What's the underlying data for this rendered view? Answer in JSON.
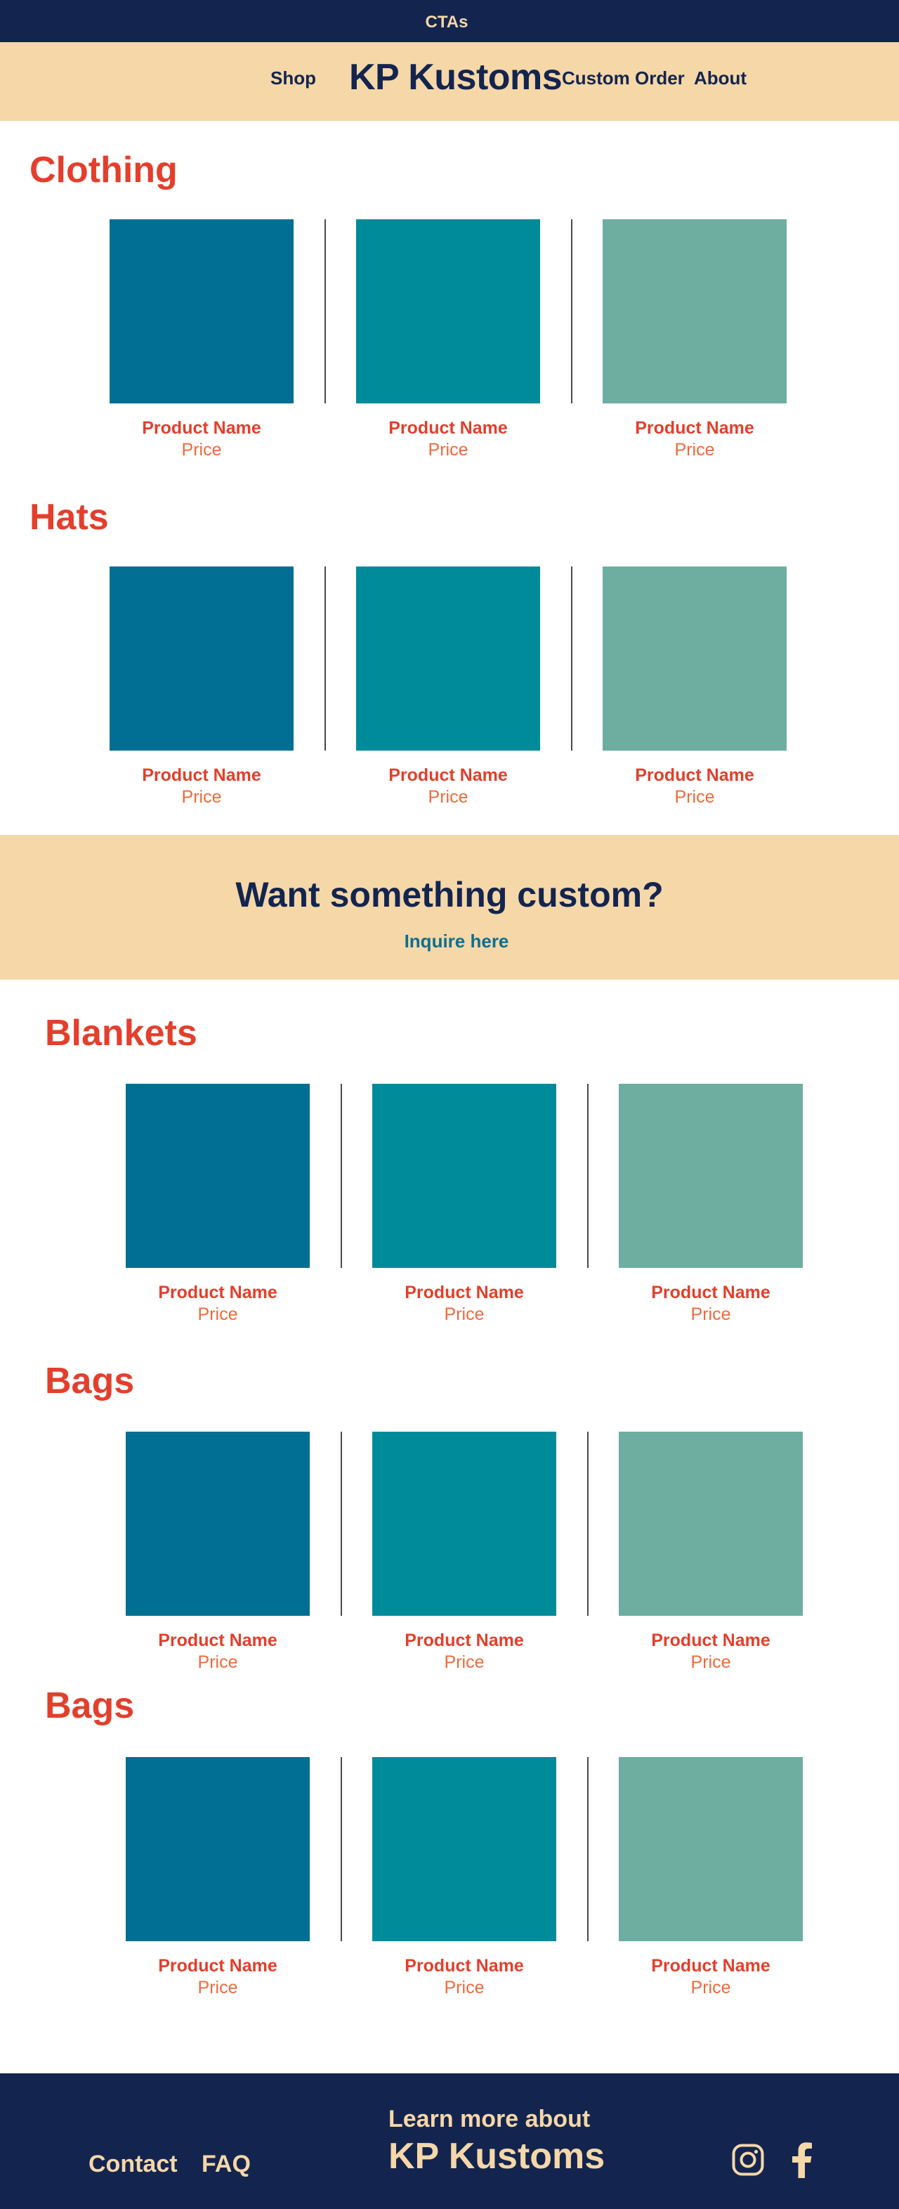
{
  "topbar": {
    "text": "CTAs"
  },
  "header": {
    "brand": "KP Kustoms",
    "nav": {
      "shop": "Shop",
      "custom_order": "Custom Order",
      "about": "About"
    }
  },
  "sections": [
    {
      "title": "Clothing",
      "products": [
        {
          "name": "Product Name",
          "price": "Price",
          "color": "#006f93"
        },
        {
          "name": "Product Name",
          "price": "Price",
          "color": "#008b9a"
        },
        {
          "name": "Product Name",
          "price": "Price",
          "color": "#6eaea0"
        }
      ]
    },
    {
      "title": "Hats",
      "products": [
        {
          "name": "Product Name",
          "price": "Price",
          "color": "#006f93"
        },
        {
          "name": "Product Name",
          "price": "Price",
          "color": "#008b9a"
        },
        {
          "name": "Product Name",
          "price": "Price",
          "color": "#6eaea0"
        }
      ]
    },
    {
      "title": "Blankets",
      "products": [
        {
          "name": "Product Name",
          "price": "Price",
          "color": "#006f93"
        },
        {
          "name": "Product Name",
          "price": "Price",
          "color": "#008b9a"
        },
        {
          "name": "Product Name",
          "price": "Price",
          "color": "#6eaea0"
        }
      ]
    },
    {
      "title": "Bags",
      "products": [
        {
          "name": "Product Name",
          "price": "Price",
          "color": "#006f93"
        },
        {
          "name": "Product Name",
          "price": "Price",
          "color": "#008b9a"
        },
        {
          "name": "Product Name",
          "price": "Price",
          "color": "#6eaea0"
        }
      ]
    },
    {
      "title": "Bags",
      "products": [
        {
          "name": "Product Name",
          "price": "Price",
          "color": "#006f93"
        },
        {
          "name": "Product Name",
          "price": "Price",
          "color": "#008b9a"
        },
        {
          "name": "Product Name",
          "price": "Price",
          "color": "#6eaea0"
        }
      ]
    }
  ],
  "custom_cta": {
    "headline": "Want something custom?",
    "link": "Inquire here"
  },
  "footer": {
    "contact": "Contact",
    "faq": "FAQ",
    "learn_more": "Learn more about",
    "brand": "KP Kustoms",
    "social": [
      "instagram-icon",
      "facebook-icon"
    ]
  },
  "colors": {
    "navy": "#13254f",
    "cream": "#f5d7a8",
    "red": "#e33f2c",
    "orange": "#ee6a3c",
    "teal_blue": "#0d6e91"
  }
}
